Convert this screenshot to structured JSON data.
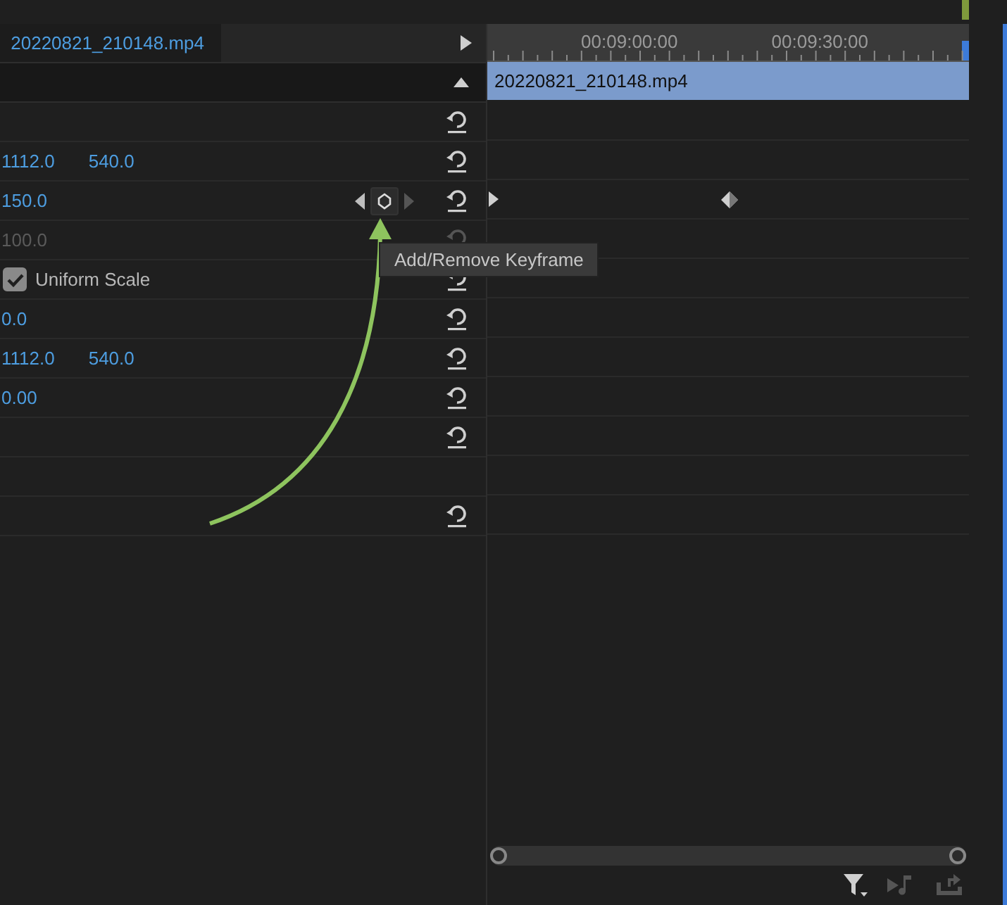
{
  "effect_controls": {
    "clip_name": "20220821_210148.mp4",
    "rows": [
      {
        "kind": "empty",
        "reset": true
      },
      {
        "kind": "values",
        "values": [
          "1112.0",
          "540.0"
        ],
        "reset": true
      },
      {
        "kind": "values",
        "values": [
          "150.0"
        ],
        "reset": true,
        "keyframe_nav": true,
        "keyframe": true
      },
      {
        "kind": "values",
        "values": [
          "100.0"
        ],
        "reset": true,
        "disabled": true
      },
      {
        "kind": "checkbox",
        "label": "Uniform Scale",
        "checked": true,
        "reset": true
      },
      {
        "kind": "values",
        "values": [
          "0.0"
        ],
        "reset": true
      },
      {
        "kind": "values",
        "values": [
          "1112.0",
          "540.0"
        ],
        "reset": true
      },
      {
        "kind": "values",
        "values": [
          "0.00"
        ],
        "reset": true
      },
      {
        "kind": "empty",
        "reset": true
      },
      {
        "kind": "empty",
        "reset": false
      },
      {
        "kind": "empty",
        "reset": true
      }
    ]
  },
  "timeline": {
    "ruler_labels": [
      "00:09:00:00",
      "00:09:30:00"
    ],
    "clip_name": "20220821_210148.mp4"
  },
  "tooltip": {
    "text": "Add/Remove Keyframe"
  }
}
